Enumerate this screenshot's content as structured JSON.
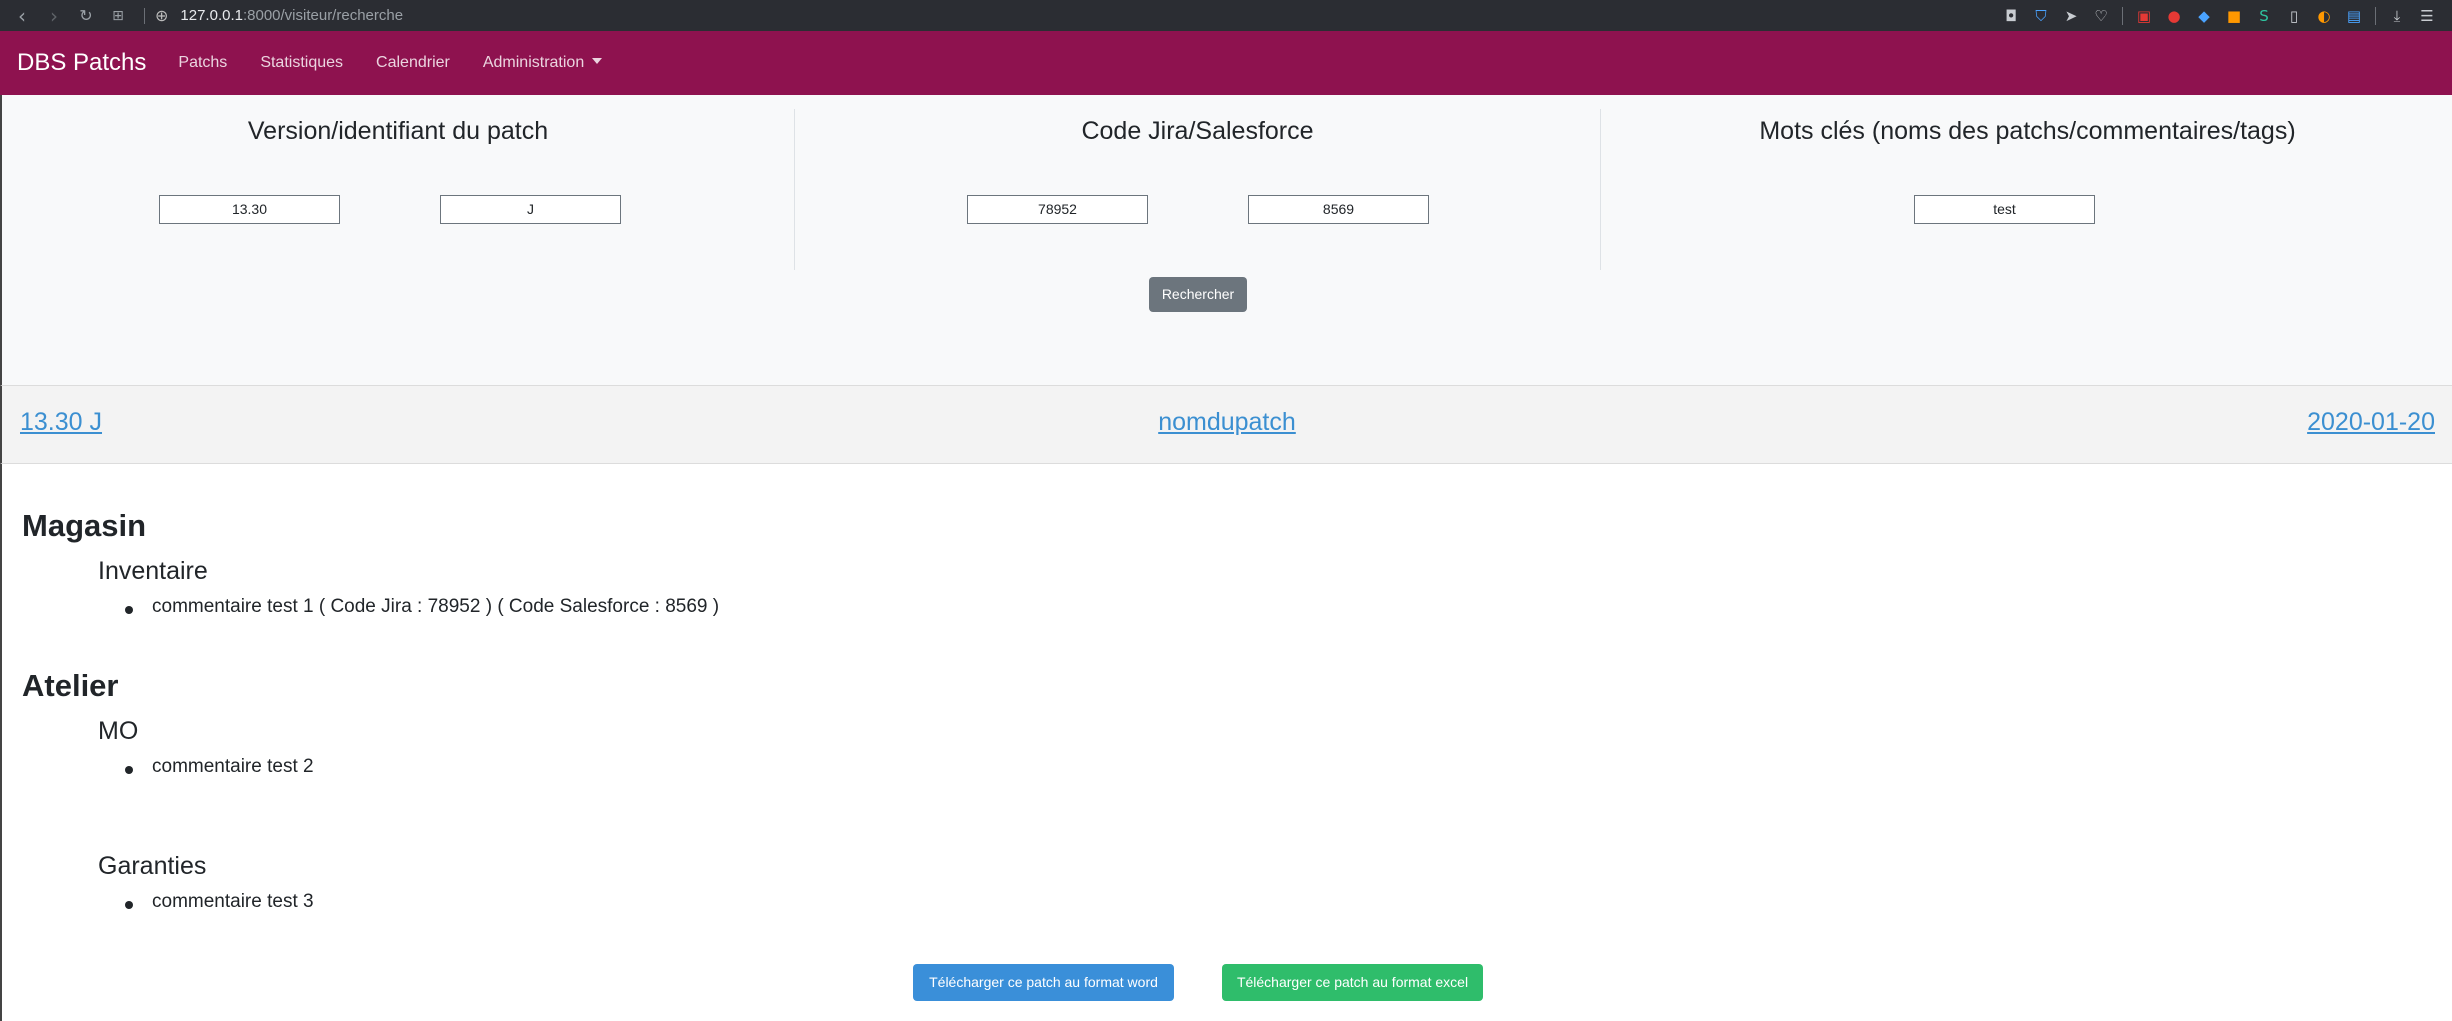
{
  "browser": {
    "url_host": "127.0.0.1",
    "url_path": ":8000/visiteur/recherche"
  },
  "navbar": {
    "brand": "DBS Patchs",
    "links": [
      "Patchs",
      "Statistiques",
      "Calendrier",
      "Administration"
    ]
  },
  "search": {
    "version_title": "Version/identifiant du patch",
    "version_value": "13.30",
    "identifier_value": "J",
    "code_title": "Code Jira/Salesforce",
    "jira_value": "78952",
    "salesforce_value": "8569",
    "keywords_title": "Mots clés (noms des patchs/commentaires/tags)",
    "keywords_value": "test",
    "submit_label": "Rechercher"
  },
  "result": {
    "version": "13.30 J",
    "name": "nomdupatch",
    "date": "2020-01-20"
  },
  "details": {
    "groups": [
      {
        "title": "Magasin",
        "subsections": [
          {
            "title": "Inventaire",
            "items": [
              "commentaire test 1 ( Code Jira : 78952 ) ( Code Salesforce : 8569 )"
            ]
          }
        ]
      },
      {
        "title": "Atelier",
        "subsections": [
          {
            "title": "MO",
            "items": [
              "commentaire test 2"
            ]
          },
          {
            "title": "Garanties",
            "items": [
              "commentaire test 3"
            ]
          }
        ]
      }
    ]
  },
  "actions": {
    "word_label": "Télécharger ce patch au format word",
    "excel_label": "Télécharger ce patch au format excel"
  },
  "colors": {
    "navbar": "#8e124f",
    "link": "#3b8fd1",
    "btn_secondary": "#6c757d",
    "btn_primary": "#3a8fd9",
    "btn_success": "#2fbd6b"
  }
}
